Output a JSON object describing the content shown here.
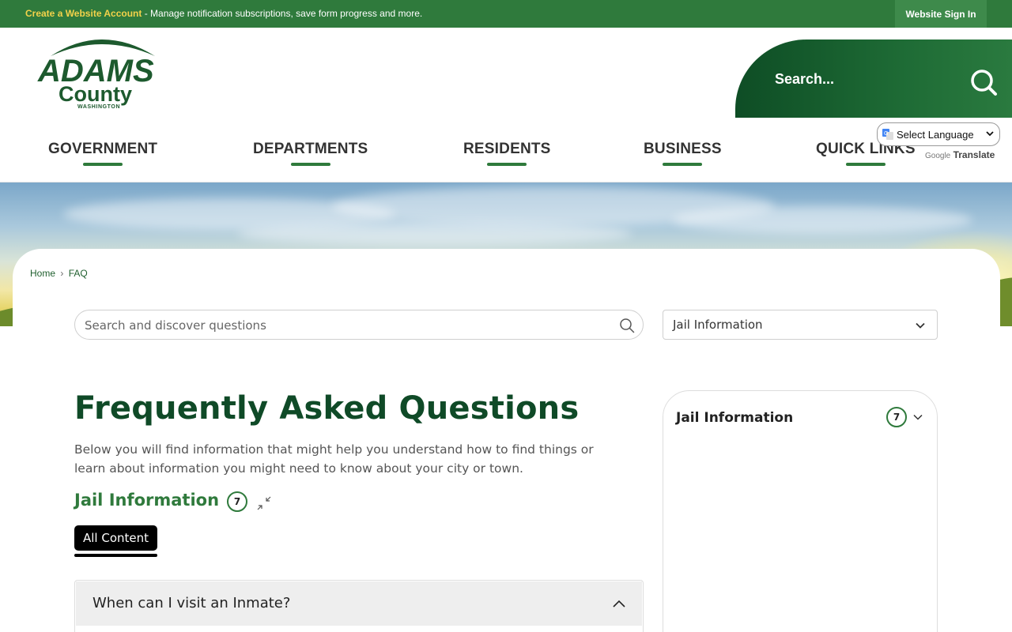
{
  "topbar": {
    "create_account_link": "Create a Website Account",
    "message": " - Manage notification subscriptions, save form progress and more.",
    "signin_label": "Website Sign In",
    "bg_color": "#2f7a3c"
  },
  "header": {
    "logo": {
      "line1": "ADAMS",
      "line2": "County",
      "line3": "WASHINGTON"
    },
    "search_placeholder": "Search...",
    "nav": [
      "GOVERNMENT",
      "DEPARTMENTS",
      "RESIDENTS",
      "BUSINESS",
      "QUICK LINKS"
    ],
    "translate": {
      "select_label": "Select Language",
      "powered_by": "Google",
      "translate_label": "Translate"
    }
  },
  "breadcrumb": {
    "home": "Home",
    "separator": "›",
    "current": "FAQ"
  },
  "faq": {
    "search_placeholder": "Search and discover questions",
    "category_select_value": "Jail Information",
    "title": "Frequently Asked Questions",
    "intro": "Below you will find information that might help you understand how to find things or learn about information you might need to know about your city or town.",
    "category_heading": "Jail Information",
    "category_count": "7",
    "tab_all": "All Content",
    "questions": [
      "When can I visit an Inmate?"
    ]
  },
  "sidebar": {
    "title": "Jail Information",
    "count": "7"
  },
  "colors": {
    "brand_green": "#2f7a3c",
    "dark_green": "#0f4a27"
  }
}
